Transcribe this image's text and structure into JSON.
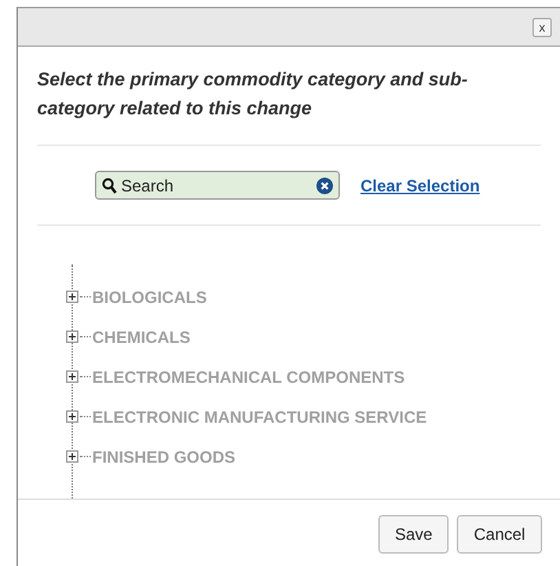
{
  "dialog": {
    "close_label": "x",
    "instruction": "Select the primary commodity category and sub-category related to this change",
    "search": {
      "placeholder": "Search"
    },
    "clear_link": "Clear Selection",
    "tree": [
      {
        "label": "BIOLOGICALS",
        "expanded": false
      },
      {
        "label": "CHEMICALS",
        "expanded": false
      },
      {
        "label": "ELECTROMECHANICAL COMPONENTS",
        "expanded": false
      },
      {
        "label": "ELECTRONIC MANUFACTURING SERVICE",
        "expanded": false
      },
      {
        "label": "FINISHED GOODS",
        "expanded": false
      }
    ],
    "buttons": [
      "Save",
      "Cancel"
    ]
  }
}
